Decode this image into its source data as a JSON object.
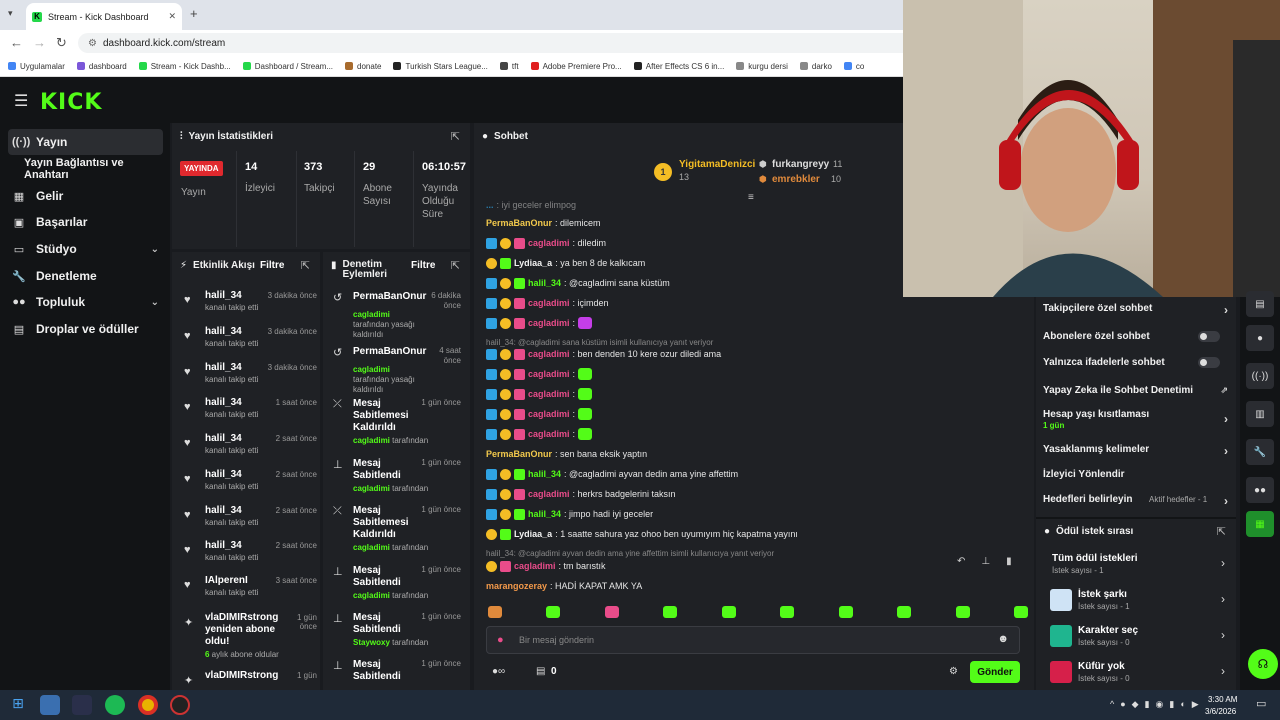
{
  "browser": {
    "tab_title": "Stream - Kick Dashboard",
    "url": "dashboard.kick.com/stream",
    "bookmarks": [
      "Uygulamalar",
      "dashboard",
      "Stream - Kick Dashb...",
      "Dashboard / Stream...",
      "donate",
      "Turkish Stars League...",
      "tft",
      "Adobe Premiere Pro...",
      "After Effects CS 6 in...",
      "kurgu dersi",
      "darko",
      "co"
    ]
  },
  "app": {
    "logo": "KICK"
  },
  "sidebar": {
    "items": [
      {
        "label": "Yayın",
        "icon": "broadcast-icon"
      },
      {
        "label": "Yayın Bağlantısı ve Anahtarı"
      },
      {
        "label": "Gelir",
        "icon": "revenue-icon"
      },
      {
        "label": "Başarılar",
        "icon": "trophy-icon"
      },
      {
        "label": "Stüdyo",
        "icon": "studio-icon"
      },
      {
        "label": "Denetleme",
        "icon": "wrench-icon"
      },
      {
        "label": "Topluluk",
        "icon": "community-icon"
      },
      {
        "label": "Droplar ve ödüller",
        "icon": "drops-icon"
      }
    ]
  },
  "stats": {
    "title": "Yayın İstatistikleri",
    "live_badge": "YAYINDA",
    "live_label": "Yayın",
    "viewers": {
      "value": "14",
      "label": "İzleyici"
    },
    "followers": {
      "value": "373",
      "label": "Takipçi"
    },
    "subs": {
      "value": "29",
      "label": "Abone Sayısı"
    },
    "duration": {
      "value": "06:10:57",
      "label": "Yayında Olduğu Süre"
    }
  },
  "activity": {
    "title": "Etkinlik Akışı",
    "filter": "Filtre",
    "items": [
      {
        "name": "halil_34",
        "sub": "kanalı takip etti",
        "time": "3 dakika önce"
      },
      {
        "name": "halil_34",
        "sub": "kanalı takip etti",
        "time": "3 dakika önce"
      },
      {
        "name": "halil_34",
        "sub": "kanalı takip etti",
        "time": "3 dakika önce"
      },
      {
        "name": "halil_34",
        "sub": "kanalı takip etti",
        "time": "1 saat önce"
      },
      {
        "name": "halil_34",
        "sub": "kanalı takip etti",
        "time": "2 saat önce"
      },
      {
        "name": "halil_34",
        "sub": "kanalı takip etti",
        "time": "2 saat önce"
      },
      {
        "name": "halil_34",
        "sub": "kanalı takip etti",
        "time": "2 saat önce"
      },
      {
        "name": "halil_34",
        "sub": "kanalı takip etti",
        "time": "2 saat önce"
      },
      {
        "name": "IAlperenI",
        "sub": "kanalı takip etti",
        "time": "3 saat önce"
      }
    ],
    "resub": {
      "name": "vlaDIMIRstrong yeniden abone oldu!",
      "sub_count": "6",
      "sub_rest": " aylık abone oldular",
      "time": "1 gün önce"
    },
    "last": {
      "name": "vlaDIMIRstrong",
      "time": "1 gün"
    }
  },
  "moderation": {
    "title": "Denetim Eylemleri",
    "filter": "Filtre",
    "by_suffix": " tarafından",
    "items": [
      {
        "title": "PermaBanOnur",
        "time": "6 dakika önce",
        "by": "cagladimi",
        "by_rest": " tarafından yasağı kaldırıldı"
      },
      {
        "title": "PermaBanOnur",
        "time": "4 saat önce",
        "by": "cagladimi",
        "by_rest": " tarafından yasağı kaldırıldı"
      },
      {
        "title": "Mesaj Sabitlemesi Kaldırıldı",
        "time": "1 gün önce",
        "by": "cagladimi"
      },
      {
        "title": "Mesaj Sabitlendi",
        "time": "1 gün önce",
        "by": "cagladimi"
      },
      {
        "title": "Mesaj Sabitlemesi Kaldırıldı",
        "time": "1 gün önce",
        "by": "cagladimi"
      },
      {
        "title": "Mesaj Sabitlendi",
        "time": "1 gün önce",
        "by": "cagladimi"
      },
      {
        "title": "Mesaj Sabitlendi",
        "time": "1 gün önce",
        "by": "Staywoxy"
      },
      {
        "title": "Mesaj Sabitlendi",
        "time": "1 gün önce",
        "by": ""
      }
    ]
  },
  "chat": {
    "title": "Sohbet",
    "top1": {
      "name": "YigitamaDenizci",
      "count": "13"
    },
    "top2": {
      "name": "furkangreyy",
      "count": "11"
    },
    "top3": {
      "name": "emrebkler",
      "count": "10"
    },
    "messages": [
      {
        "user": "PermaBanOnur",
        "text": ": dilemicem",
        "color": "#f2c94c",
        "badges": []
      },
      {
        "user": "cagladimi",
        "text": ": diledim",
        "color": "#e94c8a",
        "badges": [
          "mod",
          "sub",
          "pk"
        ]
      },
      {
        "user": "Lydiaa_a",
        "text": ": ya ben 8 de kalkıcam",
        "color": "#f2f2f2",
        "badges": [
          "sub",
          "gr"
        ]
      },
      {
        "user": "halil_34",
        "text": ": @cagladimi sana küstüm",
        "color": "#53fc18",
        "badges": [
          "mod",
          "sub",
          "gr"
        ]
      },
      {
        "user": "cagladimi",
        "text": ": içimden",
        "color": "#e94c8a",
        "badges": [
          "mod",
          "sub",
          "pk"
        ]
      },
      {
        "user": "cagladimi",
        "text": ":",
        "color": "#e94c8a",
        "badges": [
          "mod",
          "sub",
          "pk"
        ],
        "emote": true
      },
      {
        "user": "cagladimi",
        "text": ": ben denden 10 kere ozur diledi ama",
        "color": "#e94c8a",
        "badges": [
          "mod",
          "sub",
          "pk"
        ]
      },
      {
        "user": "cagladimi",
        "text": ":",
        "color": "#e94c8a",
        "badges": [
          "mod",
          "sub",
          "pk"
        ],
        "emote": true
      },
      {
        "user": "cagladimi",
        "text": ":",
        "color": "#e94c8a",
        "badges": [
          "mod",
          "sub",
          "pk"
        ],
        "emote": true
      },
      {
        "user": "cagladimi",
        "text": ":",
        "color": "#e94c8a",
        "badges": [
          "mod",
          "sub",
          "pk"
        ],
        "emote": true
      },
      {
        "user": "cagladimi",
        "text": ":",
        "color": "#e94c8a",
        "badges": [
          "mod",
          "sub",
          "pk"
        ],
        "emote": true
      },
      {
        "user": "PermaBanOnur",
        "text": ": sen bana eksik yaptın",
        "color": "#f2c94c",
        "badges": []
      },
      {
        "user": "halil_34",
        "text": ": @cagladimi ayvan dedin ama yine affettim",
        "color": "#53fc18",
        "badges": [
          "mod",
          "sub",
          "gr"
        ]
      },
      {
        "user": "cagladimi",
        "text": ": herkrs badgelerini taksın",
        "color": "#e94c8a",
        "badges": [
          "mod",
          "sub",
          "pk"
        ]
      },
      {
        "user": "halil_34",
        "text": ": jimpo hadi iyi geceler",
        "color": "#53fc18",
        "badges": [
          "mod",
          "sub",
          "gr"
        ]
      },
      {
        "user": "Lydiaa_a",
        "text": ": 1 saatte sahura yaz ohoo ben uyumıyım hiç kapatma yayını",
        "color": "#f2f2f2",
        "badges": [
          "sub",
          "gr"
        ]
      },
      {
        "user": "cagladimi",
        "text": ": tm barıstık",
        "color": "#e94c8a",
        "badges": [
          "sub",
          "pk"
        ]
      },
      {
        "user": "marangozeray",
        "text": ": HADİ KAPAT AMK YA",
        "color": "#f2994a",
        "badges": []
      }
    ],
    "reply1": "halil_34: @cagladimi sana küstüm isimli kullanıcıya yanıt veriyor",
    "reply2": "halil_34: @cagladimi ayvan dedin ama yine affettim isimli kullanıcıya yanıt veriyor",
    "top_fragment": ": iyi geceler elimpog",
    "placeholder": "Bir mesaj gönderin",
    "points": "0",
    "send": "Gönder"
  },
  "settings": {
    "items": [
      "Takipçilere özel sohbet",
      "Abonelere özel sohbet",
      "Yalnızca ifadelerle sohbet",
      "Yapay Zeka ile Sohbet Denetimi",
      "Hesap yaşı kısıtlaması",
      "Yasaklanmış kelimeler",
      "İzleyici Yönlendir",
      "Hedefleri belirleyin"
    ],
    "age_sub": "1 gün",
    "goals_sub": "Aktif hedefler - 1"
  },
  "rewards": {
    "title": "Ödül istek sırası",
    "items": [
      {
        "name": "Tüm ödül istekleri",
        "sub": "İstek sayısı - 1"
      },
      {
        "name": "İstek şarkı",
        "sub": "İstek sayısı - 1",
        "color": "#cfe3f5"
      },
      {
        "name": "Karakter seç",
        "sub": "İstek sayısı - 0",
        "color": "#1fb58f"
      },
      {
        "name": "Küfür yok",
        "sub": "İstek sayısı - 0",
        "color": "#d6204a"
      }
    ]
  },
  "taskbar": {
    "time": "3:30 AM",
    "date": "3/6/2026"
  }
}
